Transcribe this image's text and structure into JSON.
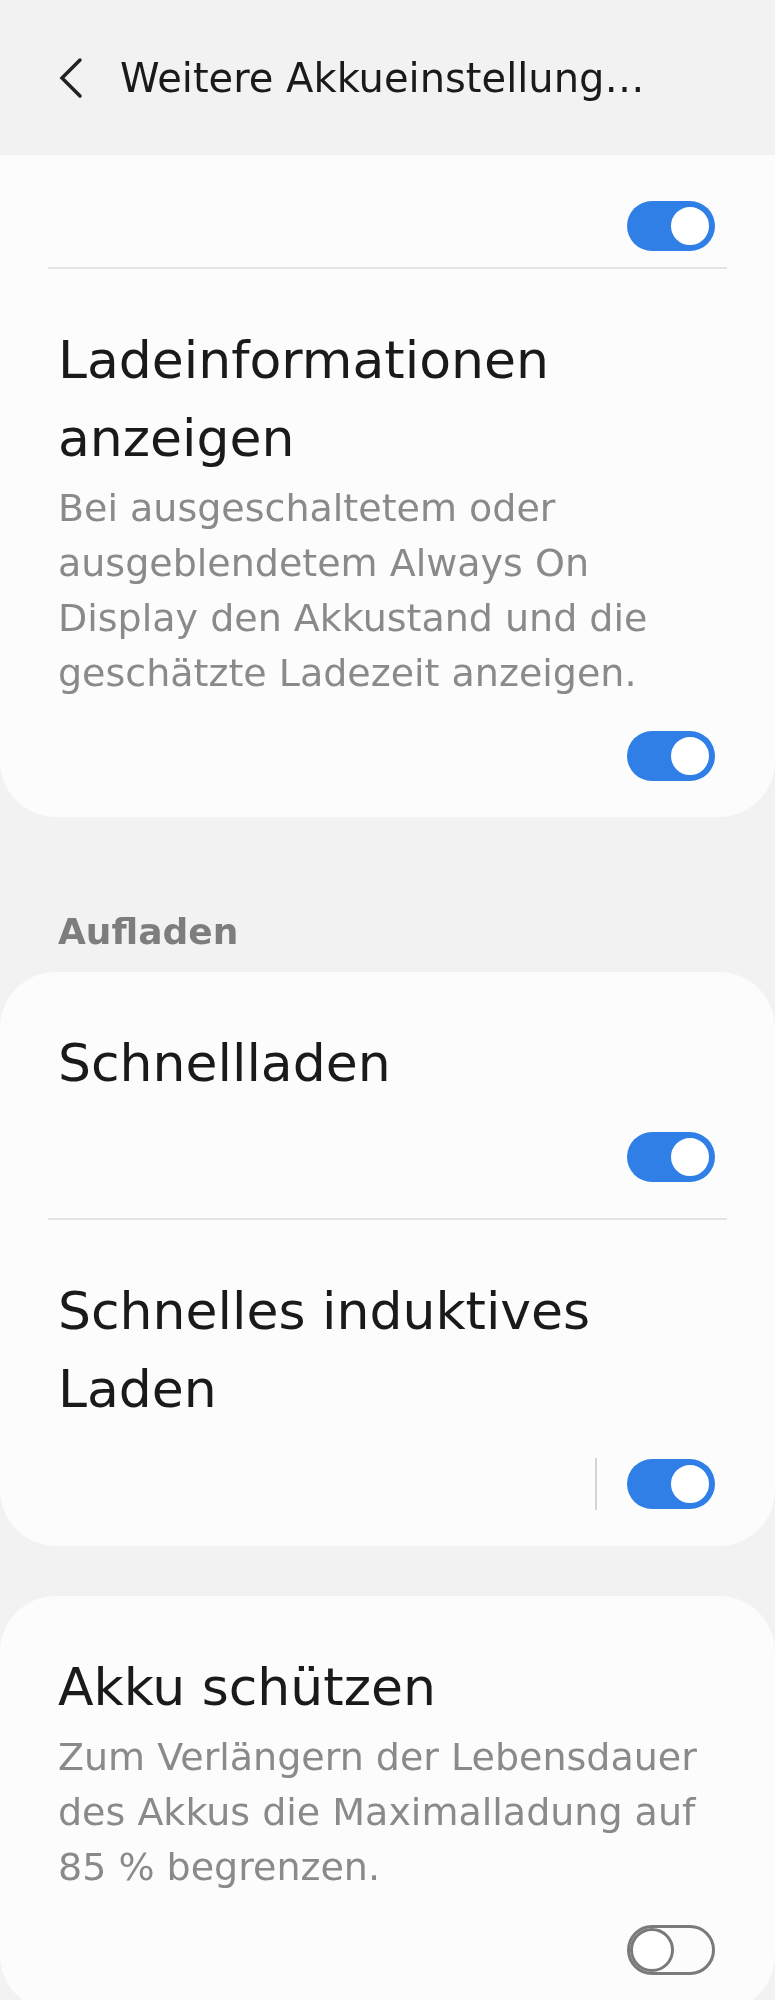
{
  "header": {
    "title": "Weitere Akkueinstellung…"
  },
  "sections": [
    {
      "items": [
        {
          "kind": "toggle_only",
          "on": true,
          "split": false
        },
        {
          "kind": "setting",
          "title": "Ladeinformationen anzeigen",
          "description": "Bei ausgeschaltetem oder ausgeblendetem Always On Display den Akkustand und die geschätzte Ladezeit anzeigen.",
          "on": true,
          "split": false
        }
      ]
    },
    {
      "heading": "Aufladen",
      "items": [
        {
          "kind": "setting",
          "title": "Schnellladen",
          "on": true,
          "split": false
        },
        {
          "kind": "setting",
          "title": "Schnelles induktives Laden",
          "on": true,
          "split": true
        }
      ]
    },
    {
      "items": [
        {
          "kind": "setting",
          "title": "Akku schützen",
          "description": "Zum Verlängern der Lebensdauer des Akkus die Maximalladung auf 85 % begrenzen.",
          "on": false,
          "split": false
        }
      ]
    }
  ]
}
